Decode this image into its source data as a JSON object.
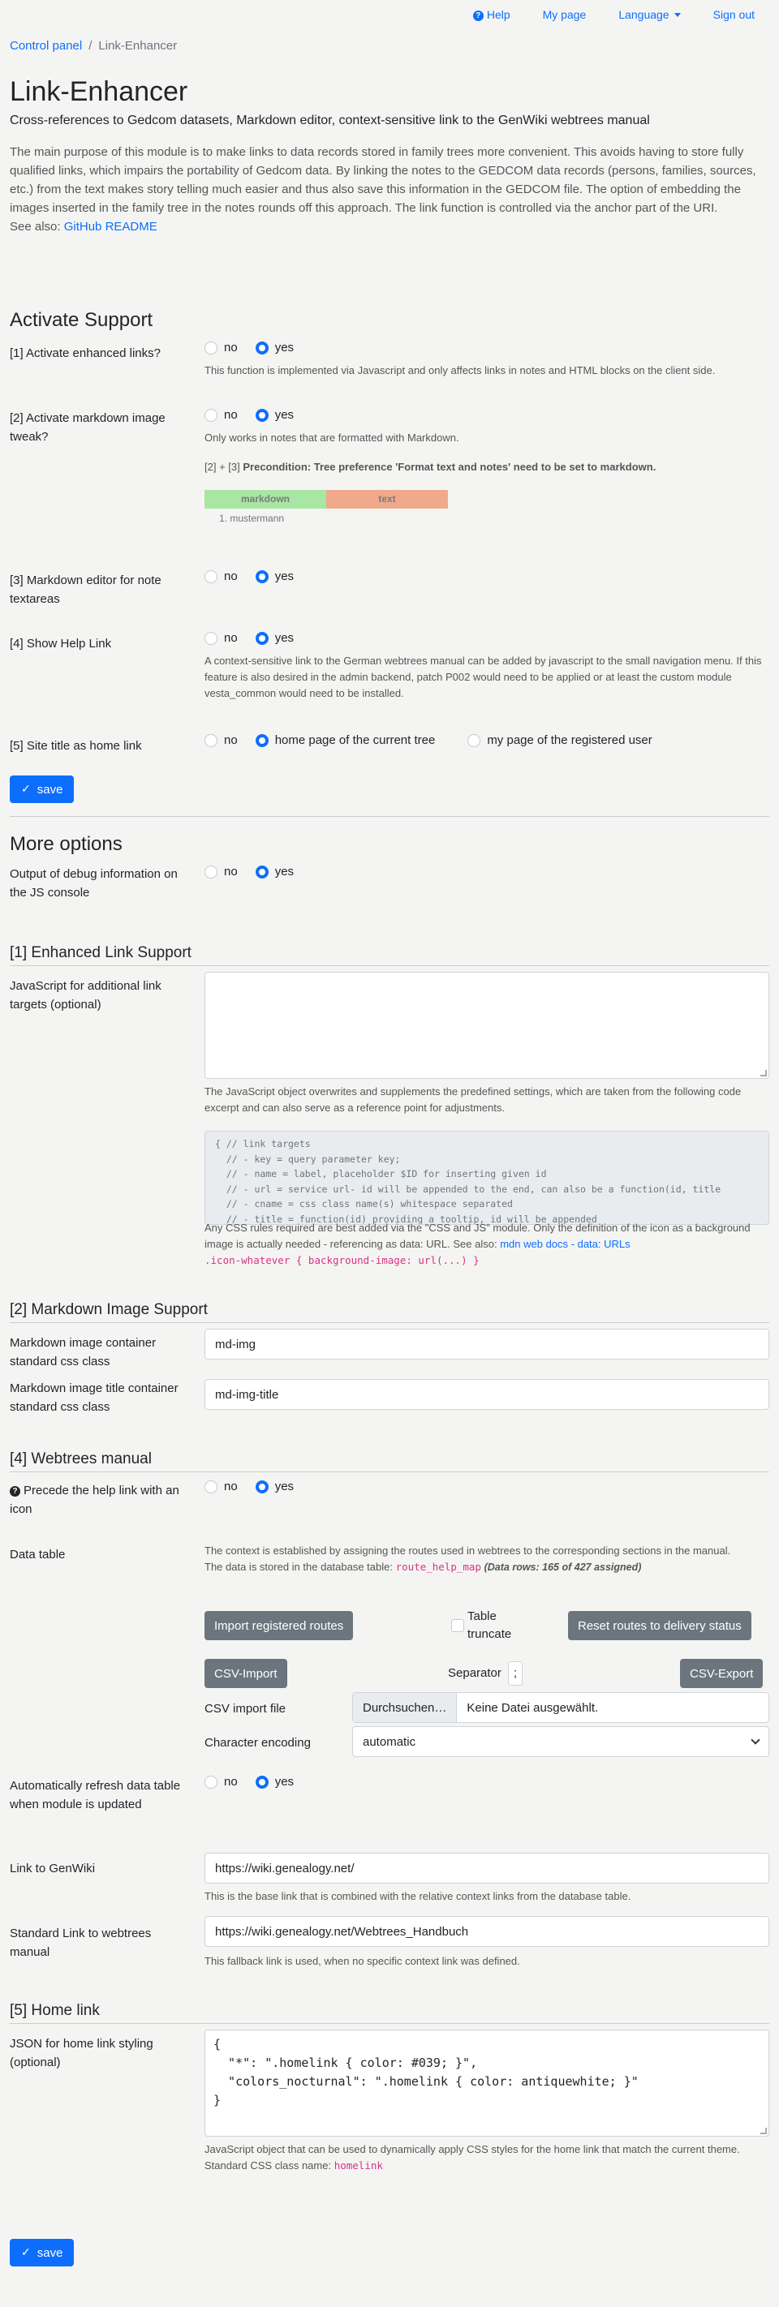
{
  "nav": {
    "help": "Help",
    "mypage": "My page",
    "language": "Language",
    "signout": "Sign out"
  },
  "breadcrumb": {
    "control_panel": "Control panel",
    "current": "Link-Enhancer"
  },
  "title": "Link-Enhancer",
  "subtitle": "Cross-references to Gedcom datasets, Markdown editor, context-sensitive link to the GenWiki webtrees manual",
  "intro": "The main purpose of this module is to make links to data records stored in family trees more convenient. This avoids having to store fully qualified links, which impairs the portability of Gedcom data. By linking the notes to the GEDCOM data records (persons, families, sources, etc.) from the text makes story telling much easier and thus also save this information in the GEDCOM file. The option of embedding the images inserted in the family tree in the notes rounds off this approach. The link function is controlled via the anchor part of the URI.",
  "see_also_label": "See also:",
  "see_also_link": "GitHub README",
  "activate": {
    "heading": "Activate Support",
    "no": "no",
    "yes": "yes",
    "q1": "[1] Activate enhanced links?",
    "q1_help": "This function is implemented via Javascript and only affects links in notes and HTML blocks on the client side.",
    "q2": "[2] Activate markdown image tweak?",
    "q2_help": "Only works in notes that are formatted with Markdown.",
    "q2_pre_prefix": "[2] + [3]",
    "q2_pre": "Precondition: Tree preference 'Format text and notes' need to be set to markdown.",
    "md_col1": "markdown",
    "md_col2": "text",
    "md_item": "mustermann",
    "q3": "[3] Markdown editor for note textareas",
    "q4": "[4] Show Help Link",
    "q4_help": "A context-sensitive link to the German webtrees manual can be added by javascript to the small navigation menu. If this feature is also desired in the admin backend, patch P002 would need to be applied or at least the custom module vesta_common would need to be installed.",
    "q5": "[5] Site title as home link",
    "q5_opt1": "no",
    "q5_opt2": "home page of the current tree",
    "q5_opt3": "my page of the registered user",
    "save": "save"
  },
  "more": {
    "heading": "More options",
    "debug": "Output of debug information on the JS console"
  },
  "els": {
    "heading": "[1] Enhanced Link Support",
    "js_label": "JavaScript for additional link targets (optional)",
    "js_help": "The JavaScript object overwrites and supplements the predefined settings, which are taken from the following code excerpt and can also serve as a reference point for adjustments.",
    "code": "{ // link targets\n  // - key = query parameter key;\n  // - name = label, placeholder $ID for inserting given id\n  // - url = service url- id will be appended to the end, can also be a function(id, title\n  // - cname = css class name(s) whitespace separated\n  // - title = function(id) providing a tooltip, id will be appended",
    "css_help": "Any CSS rules required are best added via the \"CSS and JS\" module. Only the definition of the icon as a background image is actually needed - referencing as data: URL. See also:",
    "mdn_link": "mdn web docs - data: URLs",
    "css_example": ".icon-whatever { background-image: url(...) }"
  },
  "mis": {
    "heading": "[2] Markdown Image Support",
    "container_label": "Markdown image container standard css class",
    "container_value": "md-img",
    "title_label": "Markdown image title container standard css class",
    "title_value": "md-img-title"
  },
  "wm": {
    "heading": "[4] Webtrees manual",
    "icon_label": "Precede the help link with an icon",
    "data_table_label": "Data table",
    "dt_help1": "The context is established by assigning the routes used in webtrees to the corresponding sections in the manual.",
    "dt_help2": "The data is stored in the database table:",
    "dt_table": "route_help_map",
    "dt_rows": "(Data rows: 165 of 427 assigned)",
    "import_btn": "Import registered routes",
    "truncate_label": "Table truncate",
    "reset_btn": "Reset routes to delivery status",
    "csv_import": "CSV-Import",
    "separator_label": "Separator",
    "separator_value": ";",
    "csv_export": "CSV-Export",
    "csv_file_label": "CSV import file",
    "browse": "Durchsuchen…",
    "no_file": "Keine Datei ausgewählt.",
    "encoding_label": "Character encoding",
    "encoding_value": "automatic",
    "auto_refresh_label": "Automatically refresh data table when module is updated",
    "genwiki_label": "Link to GenWiki",
    "genwiki_value": "https://wiki.genealogy.net/",
    "genwiki_help": "This is the base link that is combined with the relative context links from the database table.",
    "std_link_label": "Standard Link to webtrees manual",
    "std_link_value": "https://wiki.genealogy.net/Webtrees_Handbuch",
    "std_link_help": "This fallback link is used, when no specific context link was defined."
  },
  "hl": {
    "heading": "[5] Home link",
    "json_label": "JSON for home link styling (optional)",
    "json_value": "{\n  \"*\": \".homelink { color: #039; }\",\n  \"colors_nocturnal\": \".homelink { color: antiquewhite; }\"\n}",
    "json_help": "JavaScript object that can be used to dynamically apply CSS styles for the home link that match the current theme.",
    "std_class_label": "Standard CSS class name:",
    "std_class": "homelink",
    "save": "save"
  }
}
